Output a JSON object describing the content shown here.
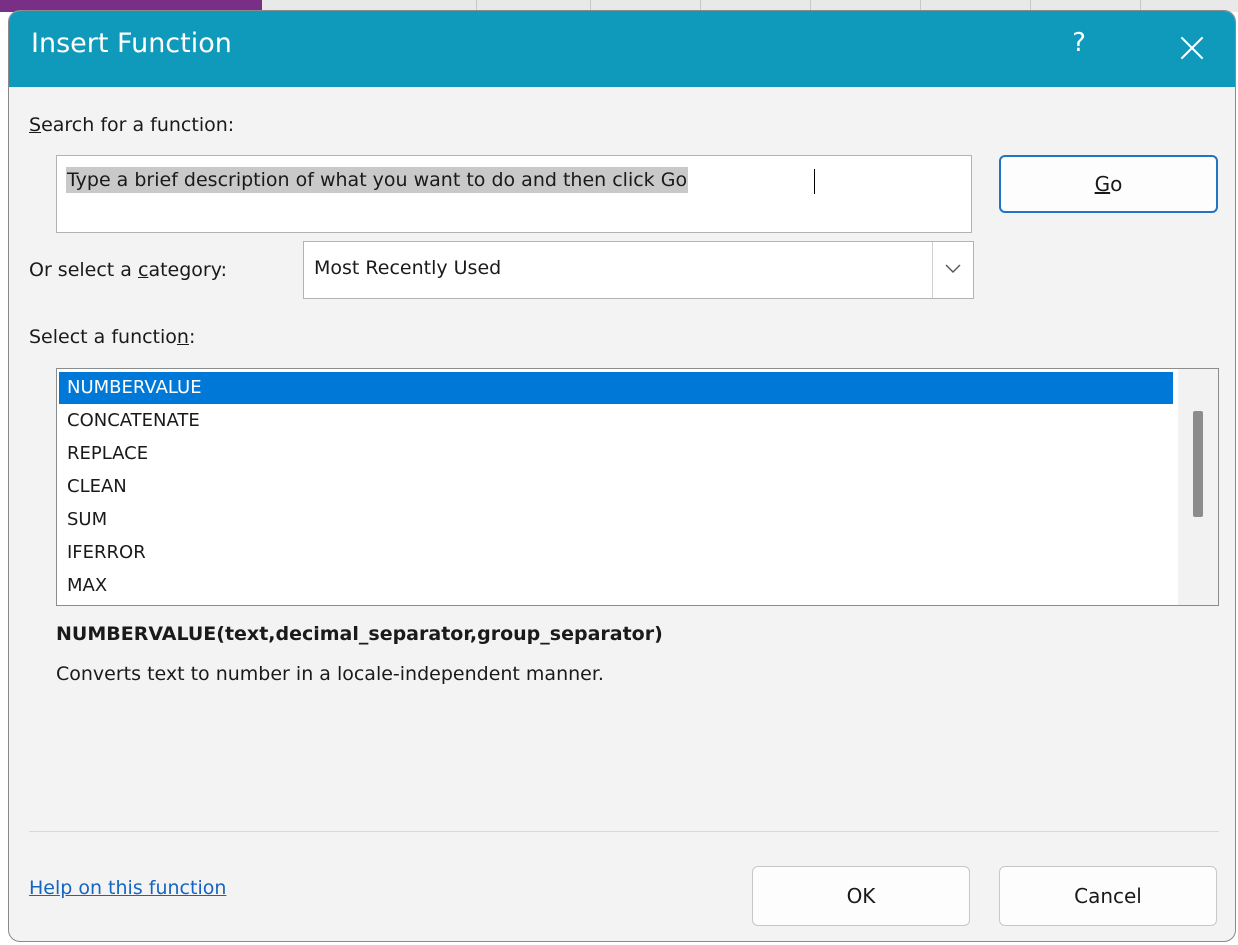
{
  "dialog": {
    "title": "Insert Function",
    "help_glyph": "?",
    "title_bar_color": "#0f99bb"
  },
  "search": {
    "label_first": "S",
    "label_rest": "earch for a function:",
    "value": "Type a brief description of what you want to do and then click Go",
    "go_first": "G",
    "go_rest": "o"
  },
  "category": {
    "label_pre": "Or select a ",
    "label_accel": "c",
    "label_post": "ategory:",
    "selected": "Most Recently Used"
  },
  "functions": {
    "label_pre": "Select a functio",
    "label_accel": "n",
    "label_post": ":",
    "items": [
      "NUMBERVALUE",
      "CONCATENATE",
      "REPLACE",
      "CLEAN",
      "SUM",
      "IFERROR",
      "MAX"
    ],
    "selected_index": 0,
    "selection_color": "#0078d7"
  },
  "details": {
    "signature": "NUMBERVALUE(text,decimal_separator,group_separator)",
    "description": "Converts text to number in a locale-independent manner."
  },
  "footer": {
    "help_link": "Help on this function",
    "ok_label": "OK",
    "cancel_label": "Cancel"
  }
}
